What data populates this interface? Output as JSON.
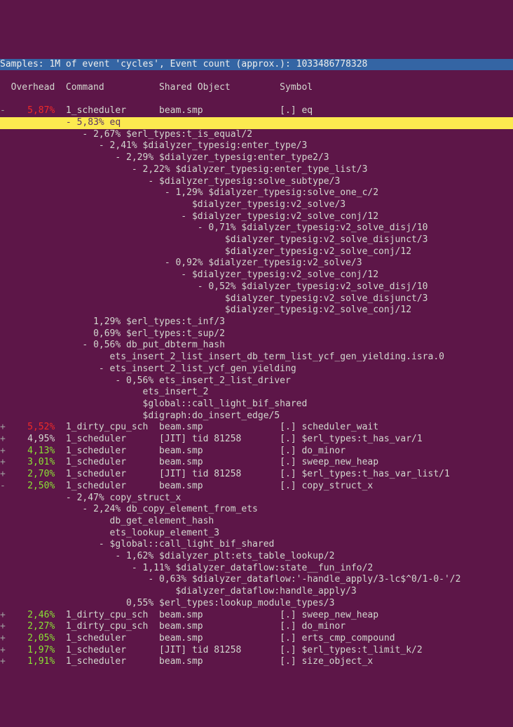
{
  "top_line": "Samples: 1M of event 'cycles', Event count (approx.): 1033486778328",
  "header_line": "  Overhead  Command          Shared Object         Symbol",
  "rows": [
    {
      "id": "r0",
      "cls": "row",
      "mark": "-",
      "pct": "5,87%",
      "pcls": "pct-red",
      "rest": "  1_scheduler      beam.smp              [.] eq"
    },
    {
      "id": "r1",
      "cls": "row sel",
      "mark": " ",
      "pct": "",
      "pcls": "",
      "rest": "  - 5,83% eq"
    },
    {
      "id": "r2",
      "cls": "row",
      "mark": " ",
      "pct": "",
      "pcls": "",
      "rest": "     - 2,67% $erl_types:t_is_equal/2"
    },
    {
      "id": "r3",
      "cls": "row",
      "mark": " ",
      "pct": "",
      "pcls": "",
      "rest": "        - 2,41% $dialyzer_typesig:enter_type/3"
    },
    {
      "id": "r4",
      "cls": "row",
      "mark": " ",
      "pct": "",
      "pcls": "",
      "rest": "           - 2,29% $dialyzer_typesig:enter_type2/3"
    },
    {
      "id": "r5",
      "cls": "row",
      "mark": " ",
      "pct": "",
      "pcls": "",
      "rest": "              - 2,22% $dialyzer_typesig:enter_type_list/3"
    },
    {
      "id": "r6",
      "cls": "row",
      "mark": " ",
      "pct": "",
      "pcls": "",
      "rest": "                 - $dialyzer_typesig:solve_subtype/3"
    },
    {
      "id": "r7",
      "cls": "row",
      "mark": " ",
      "pct": "",
      "pcls": "",
      "rest": "                    - 1,29% $dialyzer_typesig:solve_one_c/2"
    },
    {
      "id": "r8",
      "cls": "row",
      "mark": " ",
      "pct": "",
      "pcls": "",
      "rest": "                         $dialyzer_typesig:v2_solve/3"
    },
    {
      "id": "r9",
      "cls": "row",
      "mark": " ",
      "pct": "",
      "pcls": "",
      "rest": "                       - $dialyzer_typesig:v2_solve_conj/12"
    },
    {
      "id": "r10",
      "cls": "row",
      "mark": " ",
      "pct": "",
      "pcls": "",
      "rest": "                          - 0,71% $dialyzer_typesig:v2_solve_disj/10"
    },
    {
      "id": "r11",
      "cls": "row",
      "mark": " ",
      "pct": "",
      "pcls": "",
      "rest": "                               $dialyzer_typesig:v2_solve_disjunct/3"
    },
    {
      "id": "r12",
      "cls": "row",
      "mark": " ",
      "pct": "",
      "pcls": "",
      "rest": "                               $dialyzer_typesig:v2_solve_conj/12"
    },
    {
      "id": "r13",
      "cls": "row",
      "mark": " ",
      "pct": "",
      "pcls": "",
      "rest": "                    - 0,92% $dialyzer_typesig:v2_solve/3"
    },
    {
      "id": "r14",
      "cls": "row",
      "mark": " ",
      "pct": "",
      "pcls": "",
      "rest": "                       - $dialyzer_typesig:v2_solve_conj/12"
    },
    {
      "id": "r15",
      "cls": "row",
      "mark": " ",
      "pct": "",
      "pcls": "",
      "rest": "                          - 0,52% $dialyzer_typesig:v2_solve_disj/10"
    },
    {
      "id": "r16",
      "cls": "row",
      "mark": " ",
      "pct": "",
      "pcls": "",
      "rest": "                               $dialyzer_typesig:v2_solve_disjunct/3"
    },
    {
      "id": "r17",
      "cls": "row",
      "mark": " ",
      "pct": "",
      "pcls": "",
      "rest": "                               $dialyzer_typesig:v2_solve_conj/12"
    },
    {
      "id": "r18",
      "cls": "row",
      "mark": " ",
      "pct": "",
      "pcls": "",
      "rest": "       1,29% $erl_types:t_inf/3"
    },
    {
      "id": "r19",
      "cls": "row",
      "mark": " ",
      "pct": "",
      "pcls": "",
      "rest": "       0,69% $erl_types:t_sup/2"
    },
    {
      "id": "r20",
      "cls": "row",
      "mark": " ",
      "pct": "",
      "pcls": "",
      "rest": "     - 0,56% db_put_dbterm_hash"
    },
    {
      "id": "r21",
      "cls": "row",
      "mark": " ",
      "pct": "",
      "pcls": "",
      "rest": "          ets_insert_2_list_insert_db_term_list_ycf_gen_yielding.isra.0"
    },
    {
      "id": "r22",
      "cls": "row",
      "mark": " ",
      "pct": "",
      "pcls": "",
      "rest": "        - ets_insert_2_list_ycf_gen_yielding"
    },
    {
      "id": "r23",
      "cls": "row",
      "mark": " ",
      "pct": "",
      "pcls": "",
      "rest": "           - 0,56% ets_insert_2_list_driver"
    },
    {
      "id": "r24",
      "cls": "row",
      "mark": " ",
      "pct": "",
      "pcls": "",
      "rest": "                ets_insert_2"
    },
    {
      "id": "r25",
      "cls": "row",
      "mark": " ",
      "pct": "",
      "pcls": "",
      "rest": "                $global::call_light_bif_shared"
    },
    {
      "id": "r26",
      "cls": "row",
      "mark": " ",
      "pct": "",
      "pcls": "",
      "rest": "                $digraph:do_insert_edge/5"
    },
    {
      "id": "r27",
      "cls": "row",
      "mark": "+",
      "pct": "5,52%",
      "pcls": "pct-red",
      "rest": "  1_dirty_cpu_sch  beam.smp              [.] scheduler_wait"
    },
    {
      "id": "r28",
      "cls": "row",
      "mark": "+",
      "pct": "4,95%",
      "pcls": "pct-white",
      "rest": "  1_scheduler      [JIT] tid 81258       [.] $erl_types:t_has_var/1"
    },
    {
      "id": "r29",
      "cls": "row",
      "mark": "+",
      "pct": "4,13%",
      "pcls": "pct-green",
      "rest": "  1_scheduler      beam.smp              [.] do_minor"
    },
    {
      "id": "r30",
      "cls": "row",
      "mark": "+",
      "pct": "3,01%",
      "pcls": "pct-green",
      "rest": "  1_scheduler      beam.smp              [.] sweep_new_heap"
    },
    {
      "id": "r31",
      "cls": "row",
      "mark": "+",
      "pct": "2,70%",
      "pcls": "pct-green",
      "rest": "  1_scheduler      [JIT] tid 81258       [.] $erl_types:t_has_var_list/1"
    },
    {
      "id": "r32",
      "cls": "row",
      "mark": "-",
      "pct": "2,50%",
      "pcls": "pct-green",
      "rest": "  1_scheduler      beam.smp              [.] copy_struct_x"
    },
    {
      "id": "r33",
      "cls": "row",
      "mark": " ",
      "pct": "",
      "pcls": "",
      "rest": "  - 2,47% copy_struct_x"
    },
    {
      "id": "r34",
      "cls": "row",
      "mark": " ",
      "pct": "",
      "pcls": "",
      "rest": "     - 2,24% db_copy_element_from_ets"
    },
    {
      "id": "r35",
      "cls": "row",
      "mark": " ",
      "pct": "",
      "pcls": "",
      "rest": "          db_get_element_hash"
    },
    {
      "id": "r36",
      "cls": "row",
      "mark": " ",
      "pct": "",
      "pcls": "",
      "rest": "          ets_lookup_element_3"
    },
    {
      "id": "r37",
      "cls": "row",
      "mark": " ",
      "pct": "",
      "pcls": "",
      "rest": "        - $global::call_light_bif_shared"
    },
    {
      "id": "r38",
      "cls": "row",
      "mark": " ",
      "pct": "",
      "pcls": "",
      "rest": "           - 1,62% $dialyzer_plt:ets_table_lookup/2"
    },
    {
      "id": "r39",
      "cls": "row",
      "mark": " ",
      "pct": "",
      "pcls": "",
      "rest": "              - 1,11% $dialyzer_dataflow:state__fun_info/2"
    },
    {
      "id": "r40",
      "cls": "row",
      "mark": " ",
      "pct": "",
      "pcls": "",
      "rest": "                 - 0,63% $dialyzer_dataflow:'-handle_apply/3-lc$^0/1-0-'/2"
    },
    {
      "id": "r41",
      "cls": "row",
      "mark": " ",
      "pct": "",
      "pcls": "",
      "rest": "                      $dialyzer_dataflow:handle_apply/3"
    },
    {
      "id": "r42",
      "cls": "row",
      "mark": " ",
      "pct": "",
      "pcls": "",
      "rest": "             0,55% $erl_types:lookup_module_types/3"
    },
    {
      "id": "r43",
      "cls": "row",
      "mark": "+",
      "pct": "2,46%",
      "pcls": "pct-green",
      "rest": "  1_dirty_cpu_sch  beam.smp              [.] sweep_new_heap"
    },
    {
      "id": "r44",
      "cls": "row",
      "mark": "+",
      "pct": "2,27%",
      "pcls": "pct-green",
      "rest": "  1_dirty_cpu_sch  beam.smp              [.] do_minor"
    },
    {
      "id": "r45",
      "cls": "row",
      "mark": "+",
      "pct": "2,05%",
      "pcls": "pct-green",
      "rest": "  1_scheduler      beam.smp              [.] erts_cmp_compound"
    },
    {
      "id": "r46",
      "cls": "row",
      "mark": "+",
      "pct": "1,97%",
      "pcls": "pct-green",
      "rest": "  1_scheduler      [JIT] tid 81258       [.] $erl_types:t_limit_k/2"
    },
    {
      "id": "r47",
      "cls": "row",
      "mark": "+",
      "pct": "1,91%",
      "pcls": "pct-green",
      "rest": "  1_scheduler      beam.smp              [.] size_object_x"
    }
  ]
}
